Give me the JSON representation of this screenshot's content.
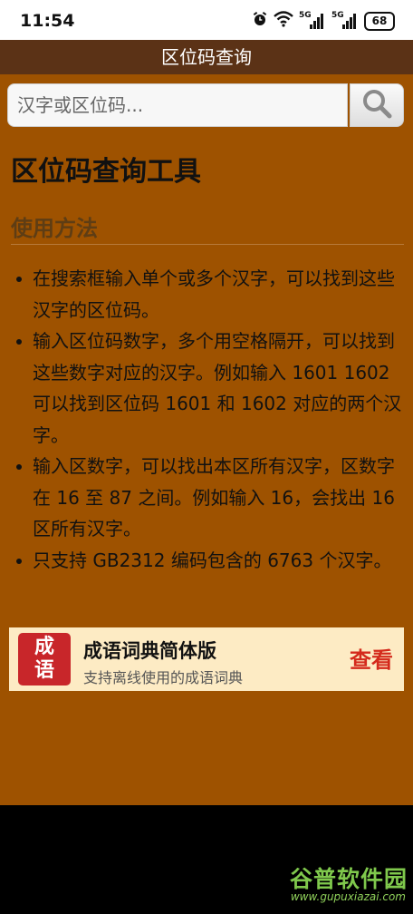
{
  "status_bar": {
    "time": "11:54",
    "signal_1": "5G",
    "signal_2": "5G",
    "battery": "68"
  },
  "app_bar": {
    "title": "区位码查询"
  },
  "search": {
    "placeholder": "汉字或区位码..."
  },
  "page": {
    "title": "区位码查询工具",
    "section_title": "使用方法",
    "usage": [
      "在搜索框输入单个或多个汉字，可以找到这些汉字的区位码。",
      "输入区位码数字，多个用空格隔开，可以找到这些数字对应的汉字。例如输入 1601 1602 可以找到区位码 1601 和 1602 对应的两个汉字。",
      "输入区数字，可以找出本区所有汉字，区数字在 16 至 87 之间。例如输入 16，会找出 16 区所有汉字。",
      "只支持 GB2312 编码包含的 6763 个汉字。"
    ]
  },
  "ad": {
    "logo_line1": "成",
    "logo_line2": "语",
    "title": "成语词典简体版",
    "subtitle": "支持离线使用的成语词典",
    "cta": "查看"
  },
  "watermark": {
    "name": "谷普软件园",
    "url": "www.gupuxiazai.com"
  },
  "colors": {
    "app_bar": "#5b3216",
    "content_bg": "#9e5200",
    "ad_bg": "#fdebc4",
    "cta": "#d42a1c"
  }
}
